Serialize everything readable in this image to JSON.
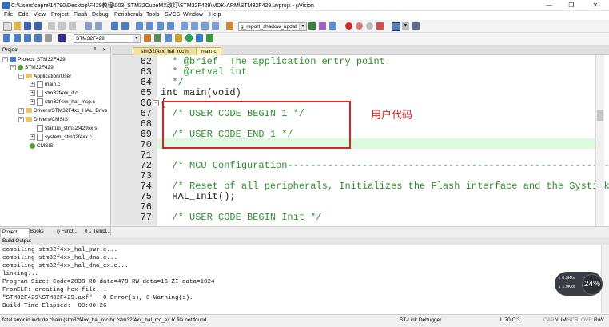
{
  "window": {
    "title": "C:\\Users\\cepre\\14790\\Desktop\\F429教程\\003_STM32CubeMX改灯\\STM32F429\\MDK-ARM\\STM32F429.uvprojx - µVision",
    "minimize": "—",
    "maximize": "❐",
    "close": "✕"
  },
  "menu": [
    "File",
    "Edit",
    "View",
    "Project",
    "Flash",
    "Debug",
    "Peripherals",
    "Tools",
    "SVCS",
    "Window",
    "Help"
  ],
  "toolbar1": {
    "search_combo": "g_report_shadow_updat"
  },
  "toolbar2": {
    "target_combo": "STM32F429"
  },
  "project_panel": {
    "title": "Project",
    "tree": [
      {
        "label": "Project: STM32F429",
        "kind": "project",
        "expand": "−"
      },
      {
        "label": "STM32F429",
        "kind": "gear",
        "expand": "−"
      },
      {
        "label": "Application/User",
        "kind": "folder",
        "expand": "−"
      },
      {
        "label": "main.c",
        "kind": "file",
        "expand": "+"
      },
      {
        "label": "stm32f4xx_it.c",
        "kind": "file",
        "expand": "+"
      },
      {
        "label": "stm32f4xx_hal_msp.c",
        "kind": "file",
        "expand": "+"
      },
      {
        "label": "Drivers/STM32F4xx_HAL_Drive",
        "kind": "folder",
        "expand": "+"
      },
      {
        "label": "Drivers/CMSIS",
        "kind": "folder",
        "expand": "−"
      },
      {
        "label": "startup_stm32f429xx.s",
        "kind": "file",
        "expand": ""
      },
      {
        "label": "system_stm32f4xx.c",
        "kind": "file",
        "expand": "+"
      },
      {
        "label": "CMSIS",
        "kind": "gear",
        "expand": ""
      }
    ],
    "bottom_tabs": [
      "Project",
      "Books",
      "{} Funct...",
      "0→ Templ..."
    ]
  },
  "editor": {
    "tabs": [
      "stm32f4xx_hal_rcc.h",
      "main.c"
    ],
    "lines": [
      {
        "num": "62",
        "text": "  * @brief  The application entry point."
      },
      {
        "num": "63",
        "text": "  * @retval int"
      },
      {
        "num": "64",
        "text": "  */"
      },
      {
        "num": "65",
        "text": "int main(void)"
      },
      {
        "num": "66",
        "text": "{"
      },
      {
        "num": "67",
        "text": "  /* USER CODE BEGIN 1 */"
      },
      {
        "num": "68",
        "text": ""
      },
      {
        "num": "69",
        "text": "  /* USER CODE END 1 */"
      },
      {
        "num": "70",
        "text": ""
      },
      {
        "num": "71",
        "text": ""
      },
      {
        "num": "72",
        "text": "  /* MCU Configuration--------------------------------------------------------"
      },
      {
        "num": "73",
        "text": ""
      },
      {
        "num": "74",
        "text": "  /* Reset of all peripherals, Initializes the Flash interface and the Systick"
      },
      {
        "num": "75",
        "text": "  HAL_Init();"
      },
      {
        "num": "76",
        "text": ""
      },
      {
        "num": "77",
        "text": "  /* USER CODE BEGIN Init */"
      }
    ],
    "annotation": "用户代码"
  },
  "build_output": {
    "title": "Build Output",
    "lines": [
      "compiling stm32f4xx_hal_pwr.c...",
      "compiling stm32f4xx_hal_dma.c...",
      "compiling stm32f4xx_hal_dma_ex.c...",
      "linking...",
      "Program Size: Code=2838 RO-data=478 RW-data=16 ZI-data=1024",
      "FromELF: creating hex file...",
      "\"STM32F429\\STM32F429.axf\" - 0 Error(s), 0 Warning(s).",
      "Build Time Elapsed:  00:00:26"
    ]
  },
  "status": {
    "message": "fatal error in include chain (stm32f4xx_hal_rcc.h): 'stm32f4xx_hal_rcc_ex.h' file not found",
    "debugger": "ST-Link Debugger",
    "position": "L:70 C:3",
    "indicators": [
      "CAP",
      "NUM",
      "SCRL",
      "OVR",
      "R/W"
    ]
  },
  "net_widget": {
    "percent": "24%",
    "up": "0.3K/s",
    "down": "1.9K/s"
  }
}
